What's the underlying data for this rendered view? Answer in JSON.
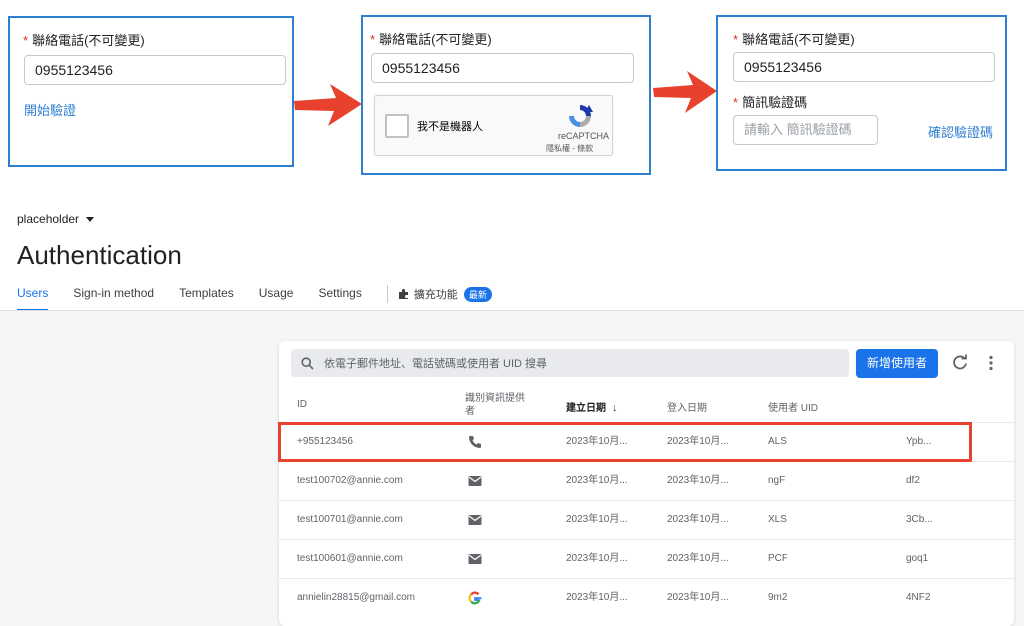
{
  "flow": {
    "panel1": {
      "field_label": "聯絡電話(不可變更)",
      "required_mark": "*",
      "phone_value": "0955123456",
      "verify_link": "開始驗證"
    },
    "panel2": {
      "field_label": "聯絡電話(不可變更)",
      "required_mark": "*",
      "phone_value": "0955123456",
      "recaptcha": {
        "checkbox_label": "我不是機器人",
        "brand": "reCAPTCHA",
        "terms": "隱私權 - 條款"
      }
    },
    "panel3": {
      "field_label": "聯絡電話(不可變更)",
      "required_mark": "*",
      "phone_value": "0955123456",
      "sms_label": "簡訊驗證碼",
      "sms_required_mark": "*",
      "sms_placeholder": "請輸入 簡訊驗證碼",
      "confirm_link": "確認驗證碼"
    }
  },
  "console": {
    "project": "placeholder",
    "title": "Authentication",
    "tabs": [
      "Users",
      "Sign-in method",
      "Templates",
      "Usage",
      "Settings"
    ],
    "extensions_label": "擴充功能",
    "badge": "最新",
    "search_placeholder": "依電子郵件地址、電話號碼或使用者 UID 搜尋",
    "add_user_button": "新增使用者",
    "columns": {
      "id": "ID",
      "provider": "識別資訊提供者",
      "created": "建立日期",
      "sort_indicator": "↓",
      "signed_in": "登入日期",
      "uid": "使用者 UID"
    },
    "rows": [
      {
        "id": "+955123456",
        "provider": "phone-icon",
        "created": "2023年10月...",
        "signed_in": "2023年10月...",
        "uid_start": "ALS",
        "uid_end": "Ypb..."
      },
      {
        "id": "test100702@annie.com",
        "provider": "email-icon",
        "created": "2023年10月...",
        "signed_in": "2023年10月...",
        "uid_start": "ngF",
        "uid_end": "df2"
      },
      {
        "id": "test100701@annie.com",
        "provider": "email-icon",
        "created": "2023年10月...",
        "signed_in": "2023年10月...",
        "uid_start": "XLS",
        "uid_end": "3Cb..."
      },
      {
        "id": "test100601@annie.com",
        "provider": "email-icon",
        "created": "2023年10月...",
        "signed_in": "2023年10月...",
        "uid_start": "PCF",
        "uid_end": "goq1"
      },
      {
        "id": "annielin28815@gmail.com",
        "provider": "google-icon",
        "created": "2023年10月...",
        "signed_in": "2023年10月...",
        "uid_start": "9m2",
        "uid_end": "4NF2"
      }
    ]
  },
  "colors": {
    "accent": "#1a73e8",
    "panel_border": "#2f7fd1",
    "highlight": "#e8422f",
    "arrow": "#e8422f",
    "required": "#d93025"
  }
}
